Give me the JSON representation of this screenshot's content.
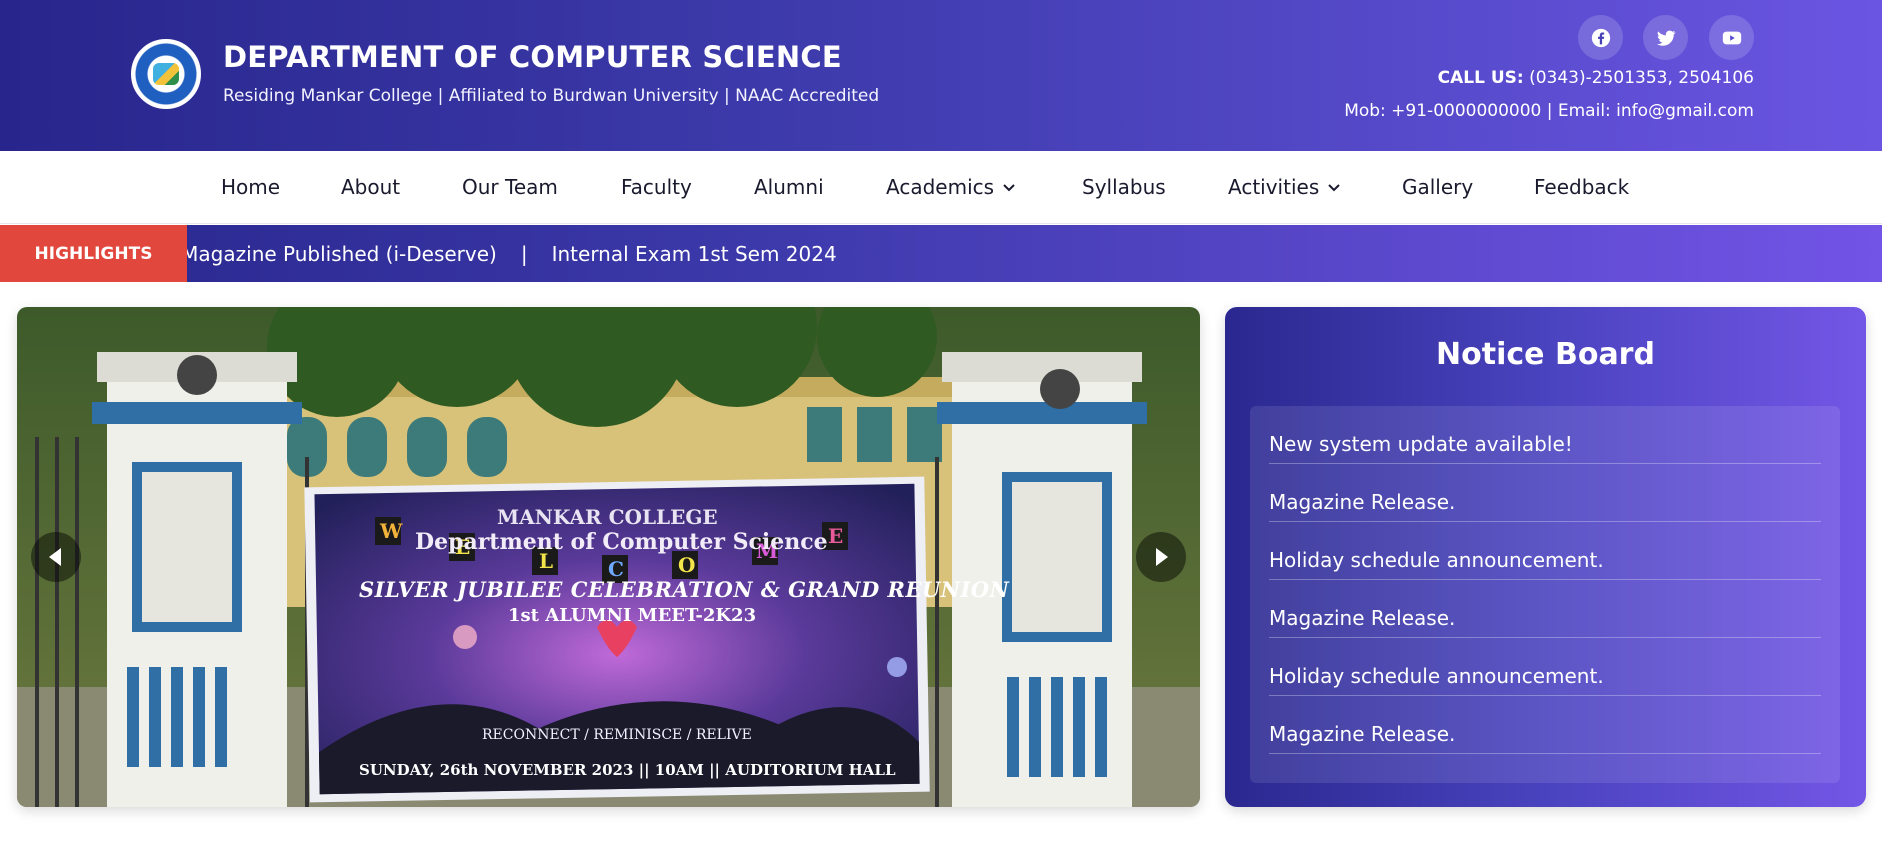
{
  "header": {
    "title": "DEPARTMENT OF COMPUTER SCIENCE",
    "subtitle": "Residing Mankar College | Affiliated to Burdwan University | NAAC Accredited",
    "call_label": "CALL US:",
    "call_numbers": " (0343)-2501353, 2504106",
    "mobile_email": "Mob: +91-0000000000 | Email: info@gmail.com",
    "social": [
      "facebook-icon",
      "twitter-icon",
      "youtube-icon"
    ]
  },
  "nav": {
    "items": [
      {
        "label": "Home"
      },
      {
        "label": "About"
      },
      {
        "label": "Our Team"
      },
      {
        "label": "Faculty"
      },
      {
        "label": "Alumni"
      },
      {
        "label": "Academics",
        "dropdown": true
      },
      {
        "label": "Syllabus"
      },
      {
        "label": "Activities",
        "dropdown": true
      },
      {
        "label": "Gallery"
      },
      {
        "label": "Feedback"
      }
    ]
  },
  "highlights": {
    "tag": "HIGHLIGHTS",
    "items": [
      "al Magazine Published (i-Deserve)",
      "Internal Exam 1st Sem 2024"
    ],
    "separator": "|"
  },
  "slider": {
    "banner": {
      "line1": "MANKAR COLLEGE",
      "line2": "Department of Computer Science",
      "line3": "SILVER JUBILEE CELEBRATION & GRAND REUNION",
      "line4": "1st ALUMNI MEET-2K23",
      "line5": "RECONNECT / REMINISCE / RELIVE",
      "line6": "SUNDAY, 26th NOVEMBER 2023 || 10AM || AUDITORIUM HALL"
    },
    "welcome_letters": [
      "W",
      "E",
      "L",
      "C",
      "O",
      "M",
      "E"
    ]
  },
  "notice_board": {
    "title": "Notice Board",
    "items": [
      "New system update available!",
      "Magazine Release.",
      "Holiday schedule announcement.",
      "Magazine Release.",
      "Holiday schedule announcement.",
      "Magazine Release."
    ]
  },
  "colors": {
    "header_start": "#28268c",
    "header_end": "#6a55e2",
    "highlight_tag": "#e2473d"
  }
}
